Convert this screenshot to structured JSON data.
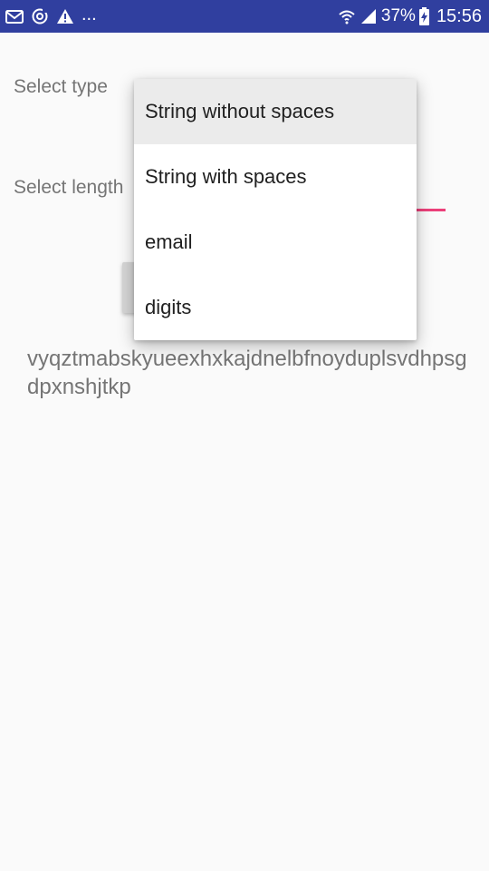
{
  "status_bar": {
    "notification_icons": [
      "gmail-icon",
      "sync-icon",
      "warning-icon"
    ],
    "overflow_dots": "...",
    "battery_percent": "37%",
    "time": "15:56"
  },
  "form": {
    "type_label": "Select type",
    "length_label": "Select length",
    "accent_color": "#e91e63"
  },
  "dropdown": {
    "items": [
      {
        "label": "String without spaces",
        "selected": true
      },
      {
        "label": "String with spaces",
        "selected": false
      },
      {
        "label": "email",
        "selected": false
      },
      {
        "label": "digits",
        "selected": false
      }
    ]
  },
  "result": {
    "text": "vyqztmabskyueexhxkajdnelbfnoyduplsvdhpsgdpxnshjtkp"
  },
  "colors": {
    "status_bar": "#303f9f",
    "background": "#fafafa"
  }
}
